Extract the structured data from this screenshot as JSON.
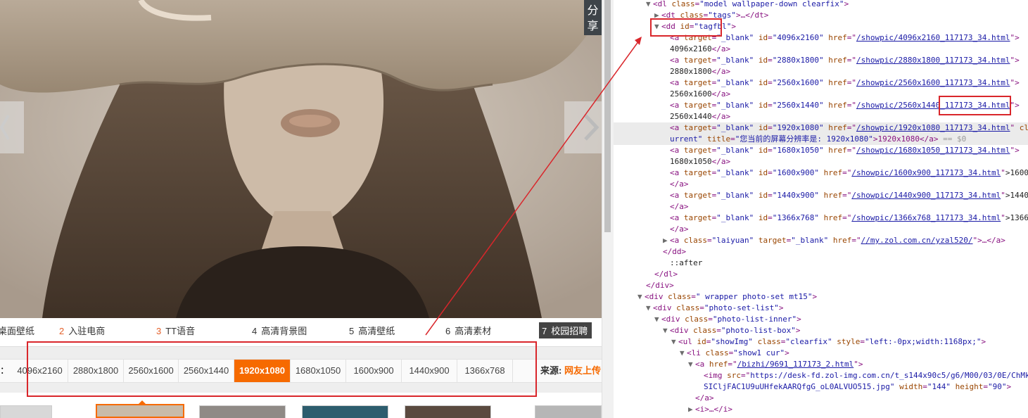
{
  "share": {
    "label": "分享"
  },
  "rank_list": [
    {
      "num": "",
      "label": "桌面壁纸"
    },
    {
      "num": "2",
      "label": "入驻电商"
    },
    {
      "num": "3",
      "label": "TT语音"
    },
    {
      "num": "4",
      "label": "高清背景图"
    },
    {
      "num": "5",
      "label": "高清壁纸"
    },
    {
      "num": "6",
      "label": "高清素材"
    },
    {
      "num": "7",
      "label": "校园招聘"
    }
  ],
  "resolution_colon": "：",
  "resolutions": [
    "4096x2160",
    "2880x1800",
    "2560x1600",
    "2560x1440",
    "1920x1080",
    "1680x1050",
    "1600x900",
    "1440x900",
    "1366x768"
  ],
  "current_resolution": "1920x1080",
  "source": {
    "label": "来源:",
    "value": "网友上传"
  },
  "colors": {
    "accent": "#f66a00",
    "annotation": "#d9262b",
    "devtools_tag": "#881280",
    "devtools_attr": "#994500",
    "devtools_value": "#1a1aa6"
  },
  "devtools": {
    "l0": {
      "tag": "<dl",
      "a1n": "class",
      "a1v": "\"model wallpaper-down clearfix\"",
      "close": ">"
    },
    "l1": {
      "tag": "<dt",
      "a1n": "class",
      "a1v": "\"tags\"",
      "rest": ">…</dt>"
    },
    "l2": {
      "tag": "<dd",
      "a1n": "id",
      "a1v": "\"tagfbl\"",
      "close": ">"
    },
    "links": [
      {
        "id": "\"4096x2160\"",
        "href": "/showpic/4096x2160_117173_34.html",
        "text": "4096x2160"
      },
      {
        "id": "\"2880x1800\"",
        "href": "/showpic/2880x1800_117173_34.html",
        "text": "2880x1800"
      },
      {
        "id": "\"2560x1600\"",
        "href": "/showpic/2560x1600_117173_34.html",
        "text": "2560x1600"
      },
      {
        "id": "\"2560x1440\"",
        "href": "/showpic/2560x1440_117173_34.html",
        "text": "2560x1440"
      }
    ],
    "current_link": {
      "id": "\"1920x1080\"",
      "href": "/showpic/1920x1080_117173_34.html",
      "cls": "cl",
      "cls2": "urrent\"",
      "title_name": "title",
      "title_val": "\"您当前的屏幕分辨率是: 1920x1080\"",
      "text": ">1920x1080</a>",
      "eq": "== $0"
    },
    "link_1680": {
      "id": "\"1680x1050\"",
      "href": "/showpic/1680x1050_117173_34.html",
      "text": "1680x1050"
    },
    "short_links": [
      {
        "id": "\"1600x900\"",
        "href": "/showpic/1600x900_117173_34.html",
        "text": ">1600"
      },
      {
        "id": "\"1440x900\"",
        "href": "/showpic/1440x900_117173_34.html",
        "text": ">1440"
      },
      {
        "id": "\"1366x768\"",
        "href": "/showpic/1366x768_117173_34.html",
        "text": ">1366"
      }
    ],
    "laiyuan": {
      "cls": "\"laiyuan\"",
      "target": "\"_blank\"",
      "href": "//my.zol.com.cn/yzal520/",
      "rest": ">…</a>"
    },
    "target_attr": "target",
    "blank_val": "\"_blank\"",
    "close_a": "</a>",
    "close_dd": "</dd>",
    "after": "::after",
    "close_dl": "</dl>",
    "close_div": "</div>",
    "div_wrapper": {
      "tag": "<div",
      "cls": "\" wrapper photo-set mt15\"",
      "close": ">"
    },
    "div_list": {
      "tag": "<div",
      "cls": "\"photo-set-list\"",
      "close": ">"
    },
    "div_inner": {
      "tag": "<div",
      "cls": "\"photo-list-inner\"",
      "close": ">"
    },
    "div_box": {
      "tag": "<div",
      "cls": "\"photo-list-box\"",
      "close": ">"
    },
    "ul": {
      "tag": "<ul",
      "id": "\"showImg\"",
      "cls": "\"clearfix\"",
      "style": "\"left:-0px;width:1168px;\"",
      "close": ">"
    },
    "li": {
      "tag": "<li",
      "cls": "\"show1 cur\"",
      "close": ">"
    },
    "a_bizhi": {
      "tag": "<a",
      "href": "/bizhi/9691_117173_2.html",
      "close": ">"
    },
    "img": {
      "tag": "<img",
      "src": "https://desk-fd.zol-img.com.cn/t_s144x90c5/g6/M00/03/0E/ChMk",
      "src2": "SICljFAC1U9uUHfekAARQfgG_oL0ALVUO515.jpg\"",
      "w": "\"144\"",
      "h": "\"90\"",
      "close": ">"
    },
    "close_a2": "</a>",
    "i": "<i>…</i>"
  }
}
